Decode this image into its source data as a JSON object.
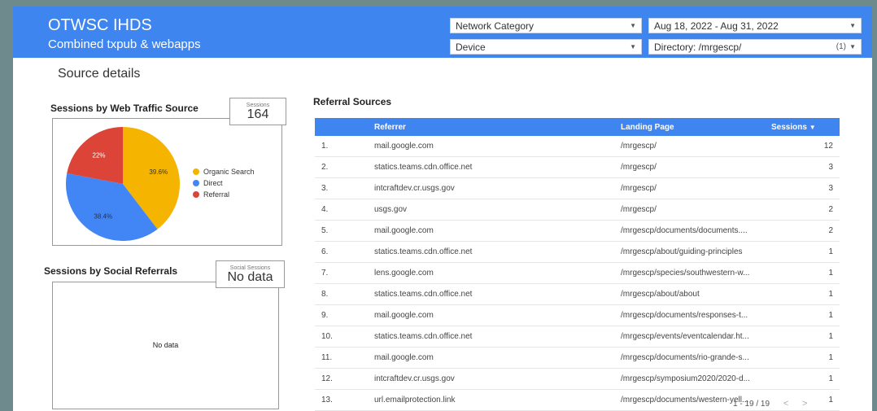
{
  "header": {
    "title": "OTWSC IHDS",
    "subtitle": "Combined txpub & webapps",
    "filters": {
      "network_category": "Network Category",
      "date_range": "Aug 18, 2022 - Aug 31, 2022",
      "device": "Device",
      "directory": "Directory: /mrgescp/",
      "directory_count": "(1)"
    }
  },
  "section_title": "Source details",
  "web_traffic": {
    "title": "Sessions by Web Traffic Source",
    "score_label": "Sessions",
    "score_value": "164"
  },
  "chart_data": {
    "type": "pie",
    "labels": [
      "Organic Search",
      "Direct",
      "Referral"
    ],
    "values": [
      39.6,
      38.4,
      22
    ],
    "value_labels": [
      "39.6%",
      "38.4%",
      "22%"
    ],
    "colors": [
      "#f4b400",
      "#4285f4",
      "#db4437"
    ],
    "legend": "right"
  },
  "social": {
    "title": "Sessions by Social Referrals",
    "score_label": "Social Sessions",
    "score_value": "No data",
    "no_data": "No data"
  },
  "referral_table": {
    "title": "Referral Sources",
    "columns": [
      "Referrer",
      "Landing Page",
      "Sessions"
    ],
    "rows": [
      {
        "num": "1.",
        "referrer": "mail.google.com",
        "landing": "/mrgescp/",
        "sessions": "12"
      },
      {
        "num": "2.",
        "referrer": "statics.teams.cdn.office.net",
        "landing": "/mrgescp/",
        "sessions": "3"
      },
      {
        "num": "3.",
        "referrer": "intcraftdev.cr.usgs.gov",
        "landing": "/mrgescp/",
        "sessions": "3"
      },
      {
        "num": "4.",
        "referrer": "usgs.gov",
        "landing": "/mrgescp/",
        "sessions": "2"
      },
      {
        "num": "5.",
        "referrer": "mail.google.com",
        "landing": "/mrgescp/documents/documents....",
        "sessions": "2"
      },
      {
        "num": "6.",
        "referrer": "statics.teams.cdn.office.net",
        "landing": "/mrgescp/about/guiding-principles",
        "sessions": "1"
      },
      {
        "num": "7.",
        "referrer": "lens.google.com",
        "landing": "/mrgescp/species/southwestern-w...",
        "sessions": "1"
      },
      {
        "num": "8.",
        "referrer": "statics.teams.cdn.office.net",
        "landing": "/mrgescp/about/about",
        "sessions": "1"
      },
      {
        "num": "9.",
        "referrer": "mail.google.com",
        "landing": "/mrgescp/documents/responses-t...",
        "sessions": "1"
      },
      {
        "num": "10.",
        "referrer": "statics.teams.cdn.office.net",
        "landing": "/mrgescp/events/eventcalendar.ht...",
        "sessions": "1"
      },
      {
        "num": "11.",
        "referrer": "mail.google.com",
        "landing": "/mrgescp/documents/rio-grande-s...",
        "sessions": "1"
      },
      {
        "num": "12.",
        "referrer": "intcraftdev.cr.usgs.gov",
        "landing": "/mrgescp/symposium2020/2020-d...",
        "sessions": "1"
      },
      {
        "num": "13.",
        "referrer": "url.emailprotection.link",
        "landing": "/mrgescp/documents/western-yell...",
        "sessions": "1"
      }
    ],
    "pagination": "1 - 19 / 19"
  }
}
